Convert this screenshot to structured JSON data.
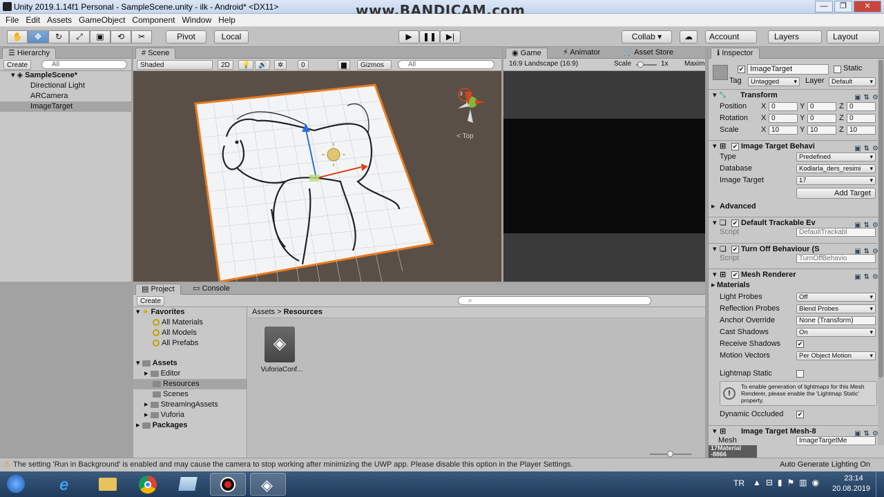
{
  "window": {
    "title": "Unity 2019.1.14f1 Personal - SampleScene.unity - ilk - Android* <DX11>",
    "watermark": "www.BANDICAM.com",
    "controls": [
      "—",
      "❐",
      "✕"
    ]
  },
  "menu": [
    "File",
    "Edit",
    "Assets",
    "GameObject",
    "Component",
    "Window",
    "Help"
  ],
  "toolbar": {
    "tools": [
      "✋",
      "✥",
      "↻",
      "⤢",
      "▣",
      "⟲",
      "✂"
    ],
    "pivot": "Pivot",
    "local": "Local",
    "play": "▶",
    "pause": "❚❚",
    "step": "▶|",
    "collab": "Collab ▾",
    "cloud": "☁",
    "account": "Account",
    "layers": "Layers",
    "layout": "Layout"
  },
  "hierarchy": {
    "tab": "Hierarchy",
    "create": "Create",
    "search_placeholder": "All",
    "scene": "SampleScene*",
    "items": [
      "Directional Light",
      "ARCamera",
      "ImageTarget"
    ]
  },
  "scene": {
    "tab": "Scene",
    "shading": "Shaded",
    "mode_2d": "2D",
    "gizmos": "Gizmos",
    "search_placeholder": "All",
    "count": "0",
    "view_label": "< Top",
    "axis_z": "z"
  },
  "game": {
    "tabs": [
      "Game",
      "Animator",
      "Asset Store"
    ],
    "aspect": "16:9 Landscape (16:9)",
    "scale_label": "Scale",
    "scale_value": "1x",
    "maximize": "Maxim"
  },
  "project": {
    "tabs": [
      "Project",
      "Console"
    ],
    "create": "Create",
    "favorites": "Favorites",
    "fav_items": [
      "All Materials",
      "All Models",
      "All Prefabs"
    ],
    "assets": "Assets",
    "asset_folders": [
      "Editor",
      "Resources",
      "Scenes",
      "StreamingAssets",
      "Vuforia"
    ],
    "packages": "Packages",
    "breadcrumb_root": "Assets",
    "breadcrumb_sep": ">",
    "breadcrumb_current": "Resources",
    "file_name": "VuforiaConf..."
  },
  "inspector": {
    "tab": "Inspector",
    "object_name": "ImageTarget",
    "static_label": "Static",
    "tag_label": "Tag",
    "tag_value": "Untagged",
    "layer_label": "Layer",
    "layer_value": "Default",
    "transform": {
      "title": "Transform",
      "rows": [
        {
          "label": "Position",
          "x": "0",
          "y": "0",
          "z": "0"
        },
        {
          "label": "Rotation",
          "x": "0",
          "y": "0",
          "z": "0"
        },
        {
          "label": "Scale",
          "x": "10",
          "y": "10",
          "z": "10"
        }
      ]
    },
    "image_target": {
      "title": "Image Target Behavi",
      "type_label": "Type",
      "type_value": "Predefined",
      "database_label": "Database",
      "database_value": "Kodlarla_ders_resimi",
      "target_label": "Image Target",
      "target_value": "17",
      "add_target": "Add Target"
    },
    "advanced": "Advanced",
    "default_trackable": {
      "title": "Default Trackable Ev",
      "script_label": "Script",
      "script_value": "DefaultTrackabl"
    },
    "turn_off": {
      "title": "Turn Off Behaviour (S",
      "script_label": "Script",
      "script_value": "TurnOffBehavio"
    },
    "mesh_renderer": {
      "title": "Mesh Renderer",
      "materials": "Materials",
      "rows": [
        {
          "label": "Light Probes",
          "value": "Off"
        },
        {
          "label": "Reflection Probes",
          "value": "Blend Probes"
        },
        {
          "label": "Anchor Override",
          "value": "None (Transform)"
        },
        {
          "label": "Cast Shadows",
          "value": "On"
        },
        {
          "label": "Receive Shadows",
          "value": "✔"
        },
        {
          "label": "Motion Vectors",
          "value": "Per Object Motion"
        }
      ],
      "lightmap_label": "Lightmap Static",
      "info": "To enable generation of lightmaps for this Mesh Renderer, please enable the 'Lightmap Static' property.",
      "dynamic_label": "Dynamic Occluded",
      "dynamic_value": "✔"
    },
    "mesh_filter": {
      "title": "Image Target Mesh-8",
      "mesh_label": "Mesh",
      "mesh_value": "ImageTargetMe"
    },
    "material_footer": "17Material",
    "footer_id": "-8866"
  },
  "statusbar": {
    "message": "The setting 'Run in Background' is enabled and may cause the camera to stop working after minimizing the UWP app. Please disable this option in the Player Settings.",
    "right": "Auto Generate Lighting On"
  },
  "taskbar": {
    "language": "TR",
    "time": "23:14",
    "date": "20.08.2019"
  },
  "colors": {
    "accent": "#5d8ec5",
    "selection": "#8fa8c8",
    "target_outline": "#e67a1f",
    "game_view": "#0b0b0b",
    "scene_bg": "#5a4f46"
  }
}
